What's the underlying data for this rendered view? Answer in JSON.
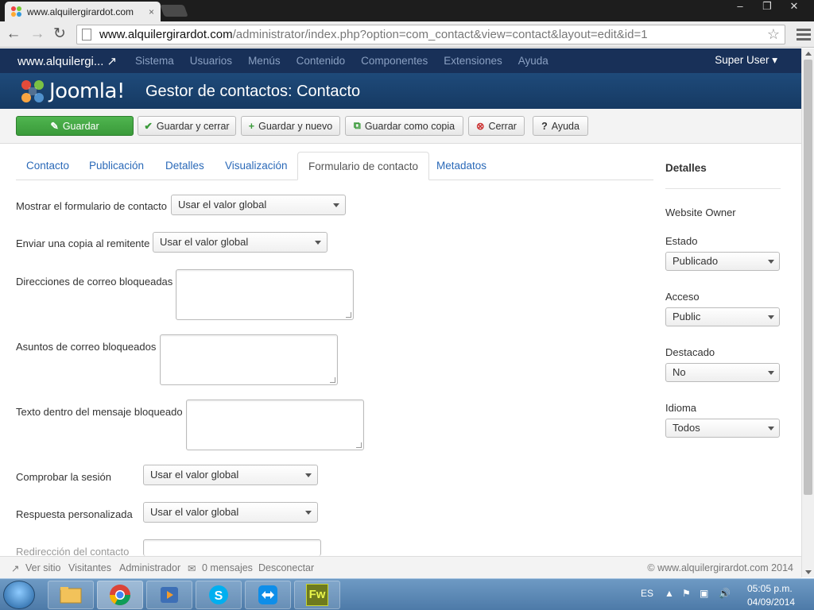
{
  "browser": {
    "tab_title": "www.alquilergirardot.com",
    "tab_close": "×",
    "url_host": "www.alquilergirardot.com",
    "url_rest": "/administrator/index.php?option=com_contact&view=contact&layout=edit&id=1",
    "win_minimize": "–",
    "win_restore": "❐",
    "win_close": "✕",
    "back": "←",
    "forward": "→",
    "reload": "↻",
    "bookmark_star": "☆"
  },
  "joomla": {
    "site_name": "www.alquilergi... ↗",
    "menu": [
      "Sistema",
      "Usuarios",
      "Menús",
      "Contenido",
      "Componentes",
      "Extensiones",
      "Ayuda"
    ],
    "user": "Super User ▾",
    "logo_word": "Joomla!",
    "page_title": "Gestor de contactos: Contacto"
  },
  "actions": {
    "save": "Guardar",
    "save_close": "Guardar y cerrar",
    "save_new": "Guardar y nuevo",
    "save_copy": "Guardar como copia",
    "close": "Cerrar",
    "help": "Ayuda"
  },
  "tabs": [
    "Contacto",
    "Publicación",
    "Detalles",
    "Visualización",
    "Formulario de contacto",
    "Metadatos"
  ],
  "form": {
    "show_form_label": "Mostrar el formulario de contacto",
    "show_form_value": "Usar el valor global",
    "send_copy_label": "Enviar una copia al remitente",
    "send_copy_value": "Usar el valor global",
    "banned_emails_label": "Direcciones de correo bloqueadas",
    "banned_subjects_label": "Asuntos de correo bloqueados",
    "banned_text_label": "Texto dentro del mensaje bloqueado",
    "session_label": "Comprobar la sesión",
    "session_value": "Usar el valor global",
    "custom_reply_label": "Respuesta personalizada",
    "custom_reply_value": "Usar el valor global",
    "redirect_label": "Redirección del contacto"
  },
  "details_panel": {
    "title": "Detalles",
    "name": "Website Owner",
    "estado_label": "Estado",
    "estado_value": "Publicado",
    "acceso_label": "Acceso",
    "acceso_value": "Public",
    "destacado_label": "Destacado",
    "destacado_value": "No",
    "idioma_label": "Idioma",
    "idioma_value": "Todos"
  },
  "status": {
    "view_site": "Ver sitio",
    "visitors": "Visitantes",
    "admin": "Administrador",
    "messages": "0 mensajes",
    "logout": "Desconectar",
    "copyright": "© www.alquilergirardot.com 2014"
  },
  "taskbar": {
    "lang": "ES",
    "time": "05:05 p.m.",
    "date": "04/09/2014",
    "fw_label": "Fw"
  },
  "colors": {
    "nav_bg": "#183058",
    "header_bg": "#1e4a7a",
    "primary_green": "#3a9a3a",
    "link_blue": "#2a69b8"
  }
}
